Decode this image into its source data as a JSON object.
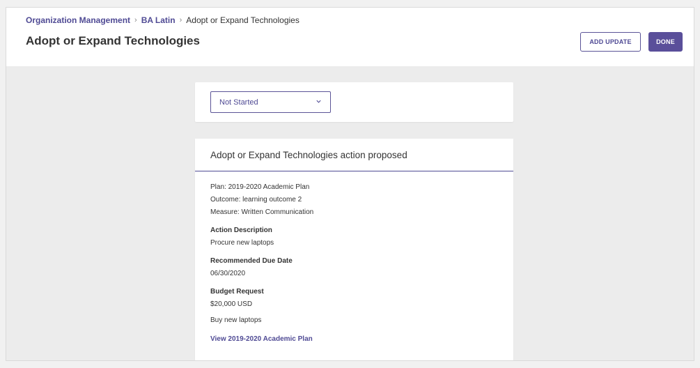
{
  "breadcrumb": {
    "items": [
      "Organization Management",
      "BA Latin"
    ],
    "current": "Adopt or Expand Technologies"
  },
  "header": {
    "title": "Adopt or Expand Technologies",
    "add_update_label": "ADD UPDATE",
    "done_label": "DONE"
  },
  "status": {
    "selected": "Not Started"
  },
  "action": {
    "title": "Adopt or Expand Technologies action proposed",
    "plan": "Plan: 2019-2020 Academic Plan",
    "outcome": "Outcome: learning outcome 2",
    "measure": "Measure: Written Communication",
    "description_label": "Action Description",
    "description": "Procure new laptops",
    "due_label": "Recommended Due Date",
    "due_date": "06/30/2020",
    "budget_label": "Budget Request",
    "budget_amount": "$20,000 USD",
    "budget_note": "Buy new laptops",
    "plan_link": "View 2019-2020 Academic Plan"
  },
  "colors": {
    "accent": "#4f4a94",
    "primary_button": "#5a4f9a",
    "page_bg": "#ececec"
  }
}
